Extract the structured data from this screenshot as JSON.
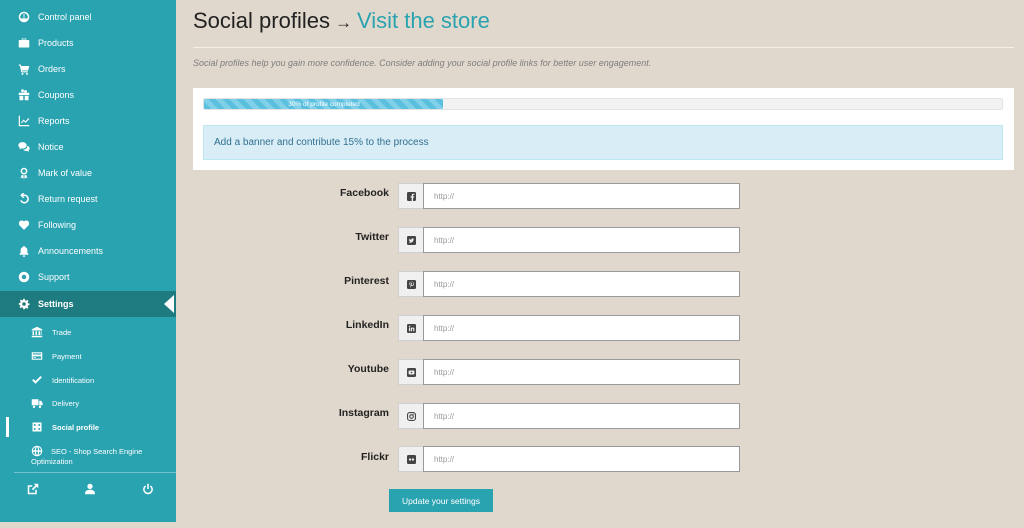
{
  "sidebar": {
    "items": [
      {
        "label": "Control panel",
        "icon": "dashboard-icon"
      },
      {
        "label": "Products",
        "icon": "briefcase-icon"
      },
      {
        "label": "Orders",
        "icon": "cart-icon"
      },
      {
        "label": "Coupons",
        "icon": "gift-icon"
      },
      {
        "label": "Reports",
        "icon": "chart-icon"
      },
      {
        "label": "Notice",
        "icon": "comments-icon"
      },
      {
        "label": "Mark of value",
        "icon": "award-icon"
      },
      {
        "label": "Return request",
        "icon": "undo-icon"
      },
      {
        "label": "Following",
        "icon": "heart-icon"
      },
      {
        "label": "Announcements",
        "icon": "bell-icon"
      },
      {
        "label": "Support",
        "icon": "lifebuoy-icon"
      },
      {
        "label": "Settings",
        "icon": "gear-icon",
        "active": true
      }
    ],
    "sub_items": [
      {
        "label": "Trade",
        "icon": "bank-icon"
      },
      {
        "label": "Payment",
        "icon": "credit-card-icon"
      },
      {
        "label": "Identification",
        "icon": "check-icon"
      },
      {
        "label": "Delivery",
        "icon": "truck-icon"
      },
      {
        "label": "Social profile",
        "icon": "share-icon",
        "active": true
      },
      {
        "label": "SEO - Shop Search Engine Optimization",
        "icon": "globe-icon"
      }
    ],
    "footer_icons": [
      "external-link-icon",
      "user-icon",
      "power-icon"
    ]
  },
  "header": {
    "title": "Social profiles",
    "arrow": "→",
    "store_link": "Visit the store"
  },
  "intro": "Social profiles help you gain more confidence. Consider adding your social profile links for better user engagement.",
  "progress": {
    "percent": 30,
    "text": "30% of profile completed"
  },
  "info": "Add a banner and contribute 15% to the process",
  "social": [
    {
      "label": "Facebook",
      "placeholder": "http://",
      "icon": "facebook-icon"
    },
    {
      "label": "Twitter",
      "placeholder": "http://",
      "icon": "twitter-icon"
    },
    {
      "label": "Pinterest",
      "placeholder": "http://",
      "icon": "pinterest-icon"
    },
    {
      "label": "LinkedIn",
      "placeholder": "http://",
      "icon": "linkedin-icon"
    },
    {
      "label": "Youtube",
      "placeholder": "http://",
      "icon": "youtube-icon"
    },
    {
      "label": "Instagram",
      "placeholder": "http://",
      "icon": "instagram-icon"
    },
    {
      "label": "Flickr",
      "placeholder": "http://",
      "icon": "flickr-icon"
    }
  ],
  "update_button": "Update your settings",
  "colors": {
    "accent": "#2aa3b1",
    "sidebar_active": "#1e7b80",
    "background": "#e0d8cc",
    "info_bg": "#d9edf7"
  }
}
